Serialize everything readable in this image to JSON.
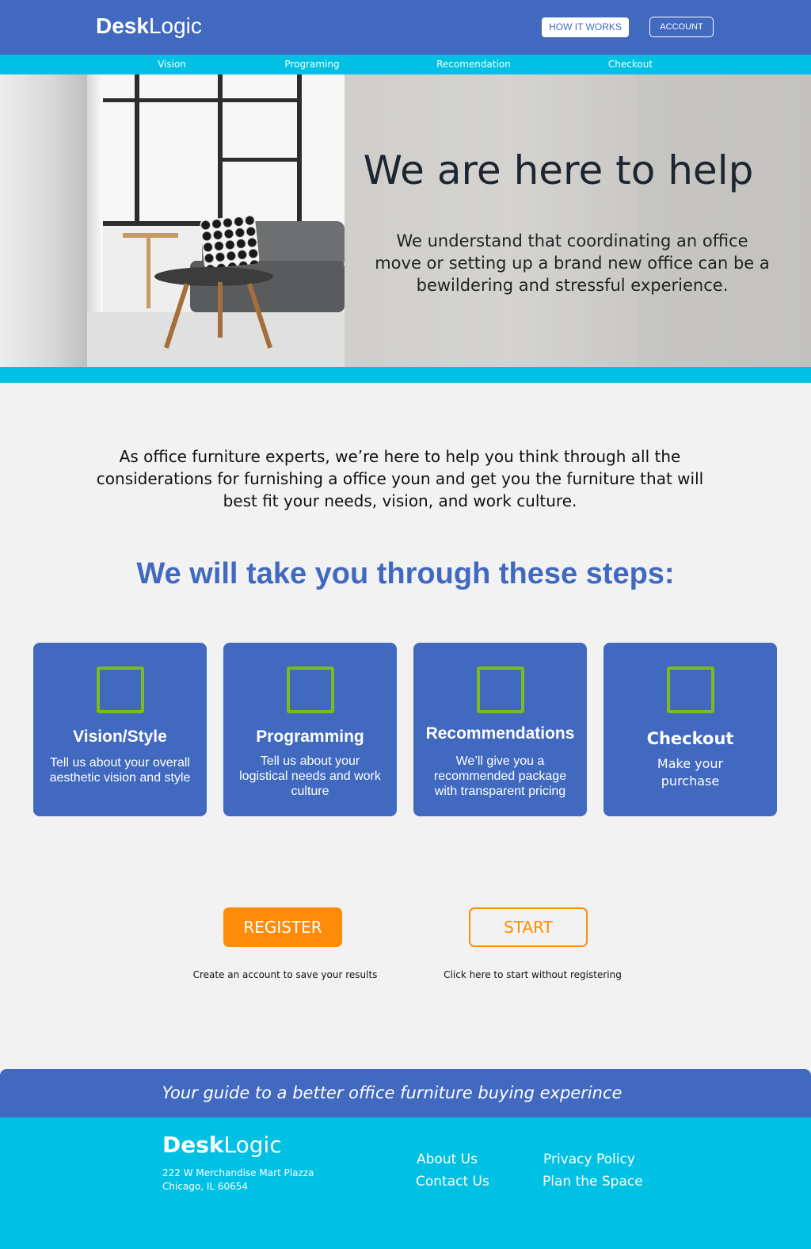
{
  "header": {
    "logo_bold": "Desk",
    "logo_light": "Logic",
    "how_it_works": "HOW IT WORKS",
    "account": "ACCOUNT"
  },
  "subnav": {
    "items": [
      {
        "label": "Vision"
      },
      {
        "label": "Programing"
      },
      {
        "label": "Recomendation"
      },
      {
        "label": "Checkout"
      }
    ]
  },
  "hero": {
    "title": "We are here to help",
    "text": "We understand that coordinating an office move or setting up a brand new office can be a bewildering and stressful experience."
  },
  "intro": "As office furniture experts, we’re here to help you think through all the considerations for furnishing a office youn and get you the furniture that will best fit your needs, vision, and work culture.",
  "steps_heading": "We will take you through these steps:",
  "steps": [
    {
      "title": "Vision/Style",
      "description": "Tell us about your overall aesthetic vision and style",
      "icon": "checkbox-icon"
    },
    {
      "title": "Programming",
      "description": "Tell us about your logistical needs and work culture",
      "icon": "checkbox-icon"
    },
    {
      "title": "Recommendations",
      "description": "We’ll give you a recommended package with transparent pricing",
      "icon": "checkbox-icon"
    },
    {
      "title": "Checkout",
      "description": "Make your purchase",
      "icon": "checkbox-icon"
    }
  ],
  "actions": {
    "register": "REGISTER",
    "register_caption": "Create an account to save your results",
    "start": "START",
    "start_caption": "Click here to start without registering"
  },
  "footer": {
    "tagline": "Your guide to a better office furniture buying experince",
    "logo_bold": "Desk",
    "logo_light": "Logic",
    "address_line1": "222 W Merchandise Mart Plazza",
    "address_line2": "Chicago, IL 60654",
    "links": [
      {
        "label": "About Us"
      },
      {
        "label": "Contact Us"
      },
      {
        "label": "Privacy Policy"
      },
      {
        "label": "Plan the Space"
      }
    ]
  },
  "colors": {
    "primary_blue": "#4169bf",
    "cyan": "#00c1e4",
    "orange": "#ff8c09",
    "check_green": "#7cbb1f",
    "background": "#f2f2f2"
  }
}
